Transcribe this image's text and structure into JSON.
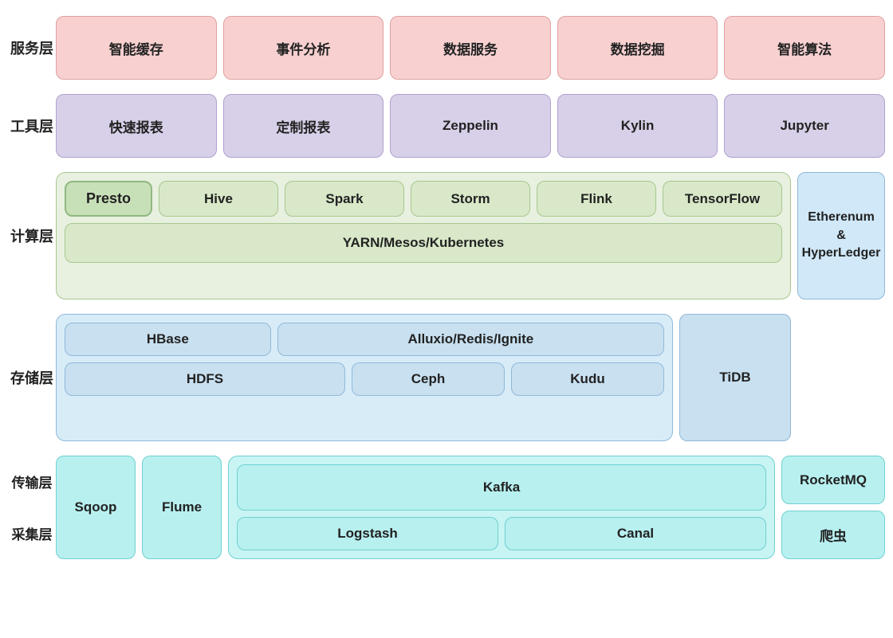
{
  "layers": {
    "service": {
      "label": "服务层",
      "items": [
        "智能缓存",
        "事件分析",
        "数据服务",
        "数据挖掘",
        "智能算法"
      ]
    },
    "tools": {
      "label": "工具层",
      "items": [
        "快速报表",
        "定制报表",
        "Zeppelin",
        "Kylin",
        "Jupyter"
      ]
    },
    "compute": {
      "label": "计算层",
      "presto": "Presto",
      "top_items": [
        "Hive",
        "Spark",
        "Storm",
        "Flink",
        "TensorFlow"
      ],
      "yarn": "YARN/Mesos/Kubernetes"
    },
    "storage": {
      "label": "存储层",
      "top_items": [
        "HBase",
        "Alluxio/Redis/Ignite"
      ],
      "tidb": "TiDB",
      "bottom_items": [
        "HDFS",
        "Ceph",
        "Kudu"
      ]
    },
    "transport_collect": {
      "transport_label": "传输层",
      "collect_label": "采集层",
      "sqoop": "Sqoop",
      "flume": "Flume",
      "kafka": "Kafka",
      "logstash": "Logstash",
      "canal": "Canal",
      "rocketmq": "RocketMQ",
      "crawler": "爬虫"
    },
    "blockchain": {
      "line1": "Etherenum",
      "line2": "&",
      "line3": "HyperLedger"
    }
  }
}
